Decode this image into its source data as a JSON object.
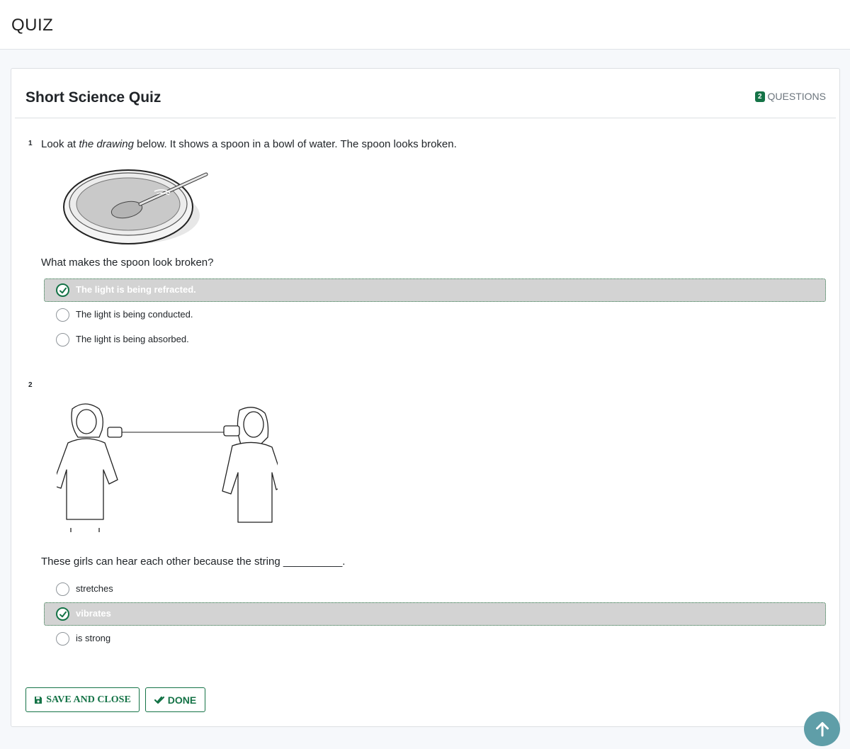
{
  "app": {
    "title": "QUIZ"
  },
  "quiz": {
    "title": "Short Science Quiz",
    "question_count": "2",
    "question_count_label": "QUESTIONS"
  },
  "questions": [
    {
      "number": "1",
      "intro_before": "Look at ",
      "intro_em": "the drawing",
      "intro_after": " below. It shows a spoon in a bowl of water. The spoon looks broken.",
      "prompt": "What makes the spoon look broken?",
      "image": "spoon-in-bowl-of-water",
      "options": [
        {
          "label": "The light is being refracted.",
          "selected": true
        },
        {
          "label": "The light is being conducted.",
          "selected": false
        },
        {
          "label": "The light is being absorbed.",
          "selected": false
        }
      ]
    },
    {
      "number": "2",
      "prompt": "These girls can hear each other because the string __________.",
      "image": "girls-with-tin-can-telephone",
      "options": [
        {
          "label": "stretches",
          "selected": false
        },
        {
          "label": "vibrates",
          "selected": true
        },
        {
          "label": "is strong",
          "selected": false
        }
      ]
    }
  ],
  "actions": {
    "save_close": "SAVE AND CLOSE",
    "done": "DONE"
  },
  "icons": {
    "save": "floppy-disk-icon",
    "done": "check-double-icon",
    "scroll_top": "arrow-up-icon",
    "selected_option": "check-circle-icon"
  },
  "colors": {
    "accent": "#157347",
    "selected_bg": "#d3d3d3",
    "fab": "#5f9ea8"
  }
}
